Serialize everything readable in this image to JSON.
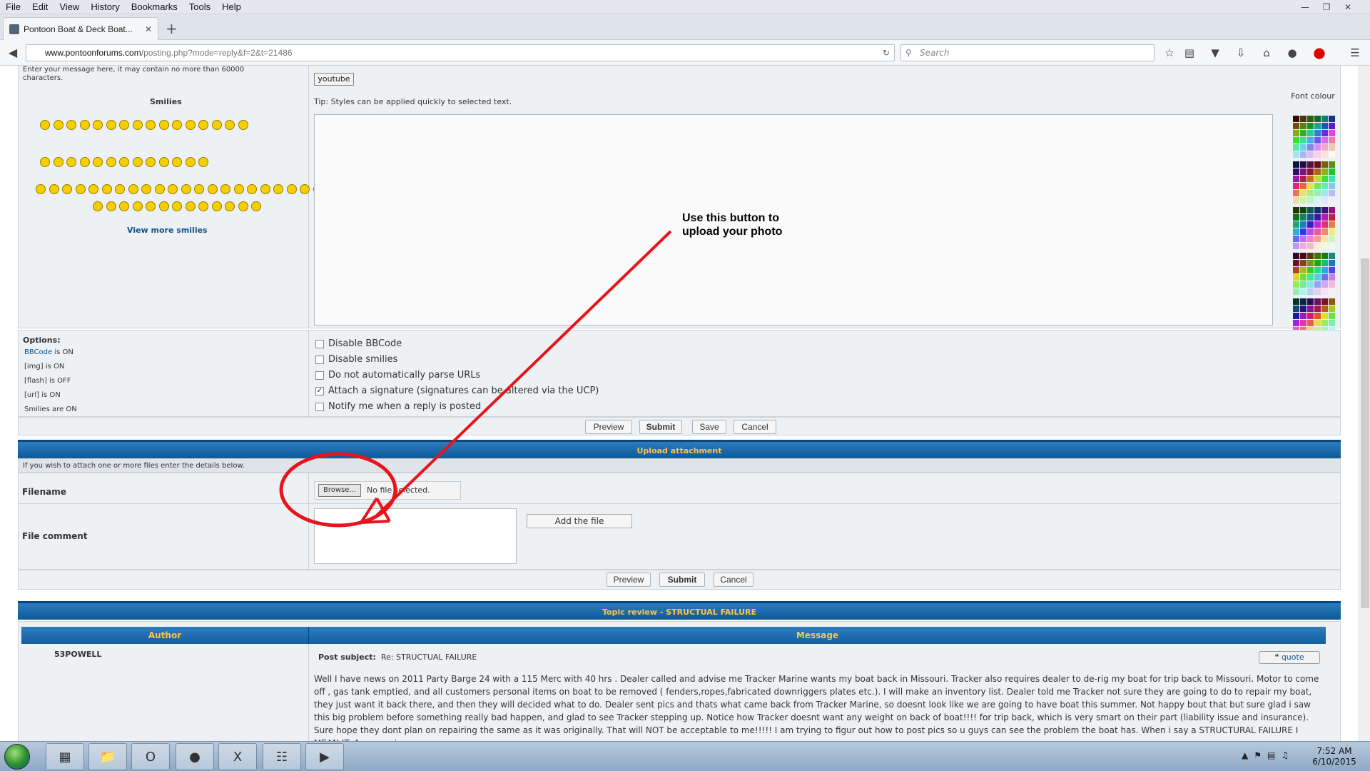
{
  "browser": {
    "menu": [
      "File",
      "Edit",
      "View",
      "History",
      "Bookmarks",
      "Tools",
      "Help"
    ],
    "window_title": "Pontoon Boat & Deck Boat...",
    "tab_title": "Pontoon Boat & Deck Boat...",
    "url_host": "www.pontoonforums.com",
    "url_path": "/posting.php?mode=reply&f=2&t=21486",
    "search_placeholder": "Search"
  },
  "editor": {
    "truncated_note_line1": "Enter your message here, it may contain no more than 60000",
    "truncated_note_line2": "characters.",
    "smilies_label": "Smilies",
    "view_more": "View more smilies",
    "youtube_button": "youtube",
    "tip": "Tip: Styles can be applied quickly to selected text.",
    "font_colour_label": "Font colour"
  },
  "options": {
    "title": "Options:",
    "status": [
      {
        "prefix": "BBCode",
        "text": " is ON",
        "link": true
      },
      {
        "prefix": "[img]",
        "text": " is ON",
        "link": false
      },
      {
        "prefix": "[flash]",
        "text": " is OFF",
        "link": false
      },
      {
        "prefix": "[url]",
        "text": " is ON",
        "link": false
      },
      {
        "prefix": "Smilies",
        "text": " are ON",
        "link": false
      }
    ],
    "checkboxes": [
      {
        "label": "Disable BBCode",
        "checked": false
      },
      {
        "label": "Disable smilies",
        "checked": false
      },
      {
        "label": "Do not automatically parse URLs",
        "checked": false
      },
      {
        "label": "Attach a signature (signatures can be altered via the UCP)",
        "checked": true
      },
      {
        "label": "Notify me when a reply is posted",
        "checked": false
      }
    ]
  },
  "buttons_top": {
    "preview": "Preview",
    "submit": "Submit",
    "save": "Save",
    "cancel": "Cancel"
  },
  "upload": {
    "header": "Upload attachment",
    "intro": "If you wish to attach one or more files enter the details below.",
    "filename_label": "Filename",
    "browse": "Browse...",
    "file_status": "No file selected.",
    "comment_label": "File comment",
    "add_file": "Add the file"
  },
  "buttons_bottom": {
    "preview": "Preview",
    "submit": "Submit",
    "cancel": "Cancel"
  },
  "annotation": {
    "text": "Use this button to upload your photo",
    "color": "#e8141c"
  },
  "topic_review": {
    "header": "Topic review - STRUCTUAL FAILURE",
    "col_author": "Author",
    "col_message": "Message",
    "author": "53POWELL",
    "subject_label": "Post subject:",
    "subject": "Re: STRUCTUAL FAILURE",
    "quote": "quote",
    "body": "Well I have news on 2011 Party Barge 24 with a 115 Merc with 40 hrs . Dealer called and advise me Tracker Marine wants my boat back in Missouri. Tracker also requires dealer to de-rig my boat for trip back to Missouri. Motor to come off , gas tank emptied, and all customers personal items on boat to be removed ( fenders,ropes,fabricated downriggers plates etc.). I will make an inventory list. Dealer told me Tracker not sure they are going to do to repair my boat, they just want it back there, and then they will decided what to do. Dealer sent pics and thats what came back from Tracker Marine, so doesnt look like we are going to have boat this summer. Not happy bout that but sure glad i saw this big problem before something really bad happen, and glad to see Tracker stepping up. Notice how Tracker doesnt want any weight on back of boat!!!! for trip back, which is very smart on their part (liability issue and insurance). Sure hope they dont plan on repairing the same as it was originally. That will NOT be acceptable to me!!!!! I am trying to figur out how to post pics so u guys can see the problem the boat has. When i say a STRUCTURAL FAILURE I MEAN IT. Anyone give"
  },
  "taskbar": {
    "time": "7:52 AM",
    "date": "6/10/2015"
  }
}
